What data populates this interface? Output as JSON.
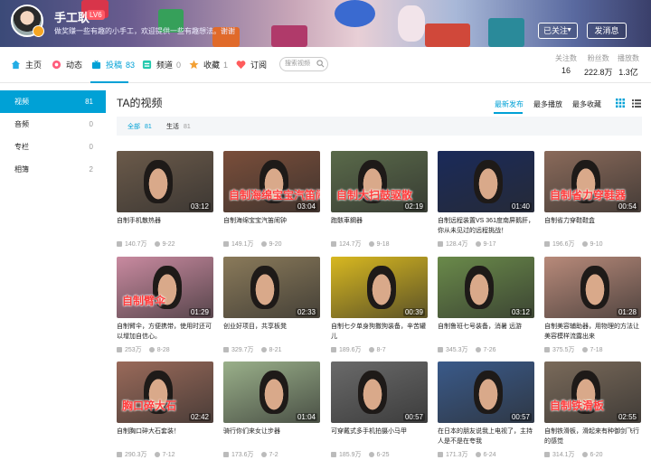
{
  "header": {
    "username": "手工耿",
    "level": "LV6",
    "signature": "做奖赚一些有趣的小手工，欢迎提供一些有趣想法。谢谢",
    "follow_button": "已关注",
    "message_button": "发消息"
  },
  "nav": {
    "items": [
      {
        "label": "主页",
        "count": "",
        "icon": "home-icon",
        "color": "#23ade5"
      },
      {
        "label": "动态",
        "count": "",
        "icon": "dynamic-icon",
        "color": "#ff5c7c"
      },
      {
        "label": "投稿",
        "count": "83",
        "icon": "tv-icon",
        "color": "#00a1d6"
      },
      {
        "label": "频道",
        "count": "0",
        "icon": "channel-icon",
        "color": "#23c9ad"
      },
      {
        "label": "收藏",
        "count": "1",
        "icon": "star-icon",
        "color": "#f3a034"
      },
      {
        "label": "订阅",
        "count": "",
        "icon": "heart-icon",
        "color": "#ff5c5c"
      }
    ],
    "search_placeholder": "搜索视频"
  },
  "stats": [
    {
      "label": "关注数",
      "value": "16"
    },
    {
      "label": "粉丝数",
      "value": "222.8万"
    },
    {
      "label": "播放数",
      "value": "1.3亿"
    }
  ],
  "sidebar": [
    {
      "label": "视频",
      "count": "81"
    },
    {
      "label": "音频",
      "count": "0"
    },
    {
      "label": "专栏",
      "count": "0"
    },
    {
      "label": "相簿",
      "count": "2"
    }
  ],
  "main": {
    "title": "TA的视频",
    "sorts": [
      "最新发布",
      "最多播放",
      "最多收藏"
    ],
    "filters": [
      {
        "label": "全部",
        "count": "81"
      },
      {
        "label": "生活",
        "count": "81"
      }
    ]
  },
  "videos": [
    {
      "title": "自制手机散热器",
      "duration": "03:12",
      "plays": "140.7万",
      "date": "9-22",
      "bg": "#6b5a4a",
      "caption": ""
    },
    {
      "title": "自制海绵宝宝汽笛闹钟",
      "duration": "03:04",
      "plays": "149.1万",
      "date": "9-20",
      "bg": "#7a4e3a",
      "caption": "自制海绵宝宝汽笛闹钟"
    },
    {
      "title": "跑骸車鋼器",
      "duration": "02:19",
      "plays": "124.7万",
      "date": "9-18",
      "bg": "#5a6a4a",
      "caption": "自制大扫鼓驱散"
    },
    {
      "title": "自制远程装置VS 361度南屏鹅肝，你从未见过的远程挑战！",
      "duration": "01:40",
      "plays": "128.4万",
      "date": "9-17",
      "bg": "#1a2a5a",
      "caption": ""
    },
    {
      "title": "自制省力穿鞋鞋盒",
      "duration": "00:54",
      "plays": "196.6万",
      "date": "9-10",
      "bg": "#8a6a5a",
      "caption": "自制省力穿鞋器"
    },
    {
      "title": "自制臂伞，方便携带，使用时还可以增加自信心。",
      "duration": "01:29",
      "plays": "253万",
      "date": "8-28",
      "bg": "#c98aa0",
      "caption": "自制臂伞"
    },
    {
      "title": "创业好项目，共享板凳",
      "duration": "02:33",
      "plays": "329.7万",
      "date": "8-21",
      "bg": "#8a7a5a",
      "caption": ""
    },
    {
      "title": "自制七夕单身狗撒狗装备，辛苦罐儿",
      "duration": "00:39",
      "plays": "189.6万",
      "date": "8-7",
      "bg": "#d8b820",
      "caption": ""
    },
    {
      "title": "自制鲁班七号装备，消暑 远游",
      "duration": "03:12",
      "plays": "345.3万",
      "date": "7-26",
      "bg": "#6a8a4a",
      "caption": ""
    },
    {
      "title": "自制美容辅助器，用物理的方法让美容模样流露出来",
      "duration": "01:28",
      "plays": "375.5万",
      "date": "7-18",
      "bg": "#b88a7a",
      "caption": ""
    },
    {
      "title": "自制胸口碎大石套装！",
      "duration": "02:42",
      "plays": "290.3万",
      "date": "7-12",
      "bg": "#9a6a5a",
      "caption": "胸口碎大石"
    },
    {
      "title": "骑行你们来女让步器",
      "duration": "01:04",
      "plays": "173.6万",
      "date": "7-2",
      "bg": "#9ab08a",
      "caption": ""
    },
    {
      "title": "可穿戴式多手机拍摄小马甲",
      "duration": "00:57",
      "plays": "185.9万",
      "date": "6-25",
      "bg": "#6a6a6a",
      "caption": ""
    },
    {
      "title": "在日本的朋友说我上电视了，主持人是不是在夸我",
      "duration": "00:57",
      "plays": "171.3万",
      "date": "6-24",
      "bg": "#3a5a8a",
      "caption": ""
    },
    {
      "title": "自制铁滑板，滑起来有种御剑飞行的感觉",
      "duration": "02:55",
      "plays": "314.1万",
      "date": "6-20",
      "bg": "#7a6a5a",
      "caption": "自制铁滑板"
    }
  ]
}
